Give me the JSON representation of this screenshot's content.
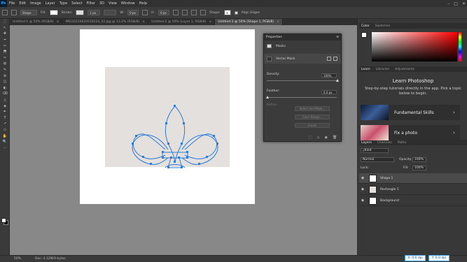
{
  "app": {
    "logo": "Ps",
    "window_controls": [
      "–",
      "□",
      "✕"
    ]
  },
  "menu": [
    "File",
    "Edit",
    "Image",
    "Layer",
    "Type",
    "Select",
    "Filter",
    "3D",
    "View",
    "Window",
    "Help"
  ],
  "options_bar": {
    "mode": "Shape",
    "fill_label": "Fill:",
    "stroke_label": "Stroke:",
    "stroke_width": "1 px",
    "w_label": "W:",
    "h_label": "H:",
    "w_value": "0 px",
    "h_value": "0 px",
    "shape_label": "Shape:",
    "align_edges": "Align Edges"
  },
  "tabs": [
    {
      "label": "Untitled-1 @ 50% (RGB/8)",
      "active": false
    },
    {
      "label": "IMG20220620150224_02.jpg @ 13.2% (RGB/8)",
      "active": false
    },
    {
      "label": "Untitled-2 @ 50% (Layer 1, RGB/8)",
      "active": false
    },
    {
      "label": "Untitled-3 @ 50% (Shape 1, RGB/8)",
      "active": true
    }
  ],
  "tools": [
    "⬚",
    "↖",
    "✥",
    "⌖",
    "✂",
    "⬒",
    "✑",
    "◍",
    "✎",
    "⊜",
    "◫",
    "◐",
    "⌫",
    "△",
    "◈",
    "✒",
    "T",
    "↗",
    "▭",
    "✋",
    "🔍",
    "⋯"
  ],
  "properties": {
    "title": "Properties",
    "section": "Masks",
    "mask_type": "Vector Mask",
    "density_label": "Density:",
    "density_value": "100%",
    "feather_label": "Feather:",
    "feather_value": "0.0 px",
    "refine_label": "Refine:",
    "btn_select_mask": "Select and Mask...",
    "btn_color_range": "Color Range...",
    "btn_invert": "Invert"
  },
  "color_panel": {
    "tabs": [
      "Color",
      "Swatches"
    ],
    "fg": "#ffffff",
    "bg": "#000000",
    "hue": "#ff0000"
  },
  "learn_panel": {
    "tabs": [
      "Learn",
      "Libraries",
      "Adjustments"
    ],
    "title": "Learn Photoshop",
    "desc": "Step-by-step tutorials directly in the app. Pick a topic below to begin.",
    "cards": [
      {
        "label": "Fundamental Skills",
        "thumb": "#1b2e4f"
      },
      {
        "label": "Fix a photo",
        "thumb": "#c9d2b5"
      }
    ]
  },
  "layers_panel": {
    "tabs": [
      "Layers",
      "Channels",
      "Paths"
    ],
    "kind": "Kind",
    "blend": "Normal",
    "opacity_label": "Opacity:",
    "opacity_value": "100%",
    "lock_label": "Lock:",
    "fill_label": "Fill:",
    "fill_value": "100%",
    "layers": [
      {
        "name": "Shape 1",
        "selected": true
      },
      {
        "name": "Rectangle 1",
        "selected": false
      },
      {
        "name": "Background",
        "selected": false
      }
    ]
  },
  "status": {
    "zoom": "50%",
    "doc": "Doc: 4.12M/0 bytes",
    "x_dpi": "X: 0.0 dpi",
    "y_dpi": "Y: 0.0 dpi"
  }
}
